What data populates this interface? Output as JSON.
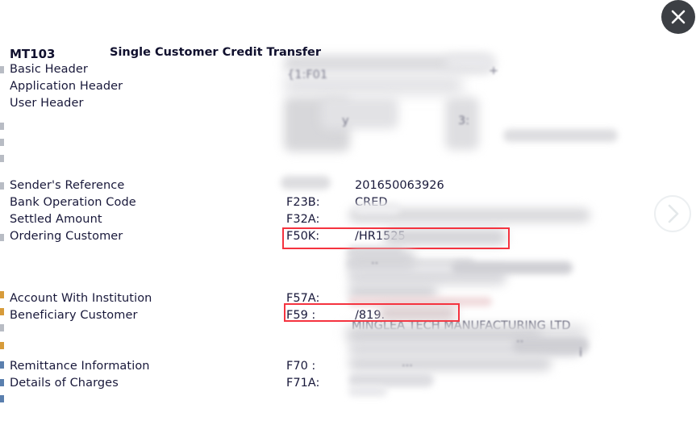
{
  "window": {
    "close_label": "×",
    "next_label": "›",
    "background": "#ffffff",
    "accent_red": "#f5333f",
    "text_color": "#18183a"
  },
  "message": {
    "type": "MT103",
    "description": "Single Customer Credit Transfer",
    "header_items": [
      {
        "label": "Basic Header"
      },
      {
        "label": "Application Header"
      },
      {
        "label": "User Header"
      }
    ],
    "fields": [
      {
        "label": "Sender's Reference",
        "tag": "",
        "tag_redacted": true,
        "value": "201650063926",
        "highlight": false
      },
      {
        "label": "Bank Operation Code",
        "tag": "F23B:",
        "tag_redacted": false,
        "value": "CRED",
        "highlight": false
      },
      {
        "label": "Settled Amount",
        "tag": "F32A:",
        "tag_redacted": false,
        "value": "",
        "value_redacted": true,
        "highlight": false
      },
      {
        "label": "Ordering Customer",
        "tag": "F50K:",
        "tag_redacted": false,
        "value": "/HR1525",
        "value_redacted": true,
        "highlight": true
      },
      {
        "label": "Account With Institution",
        "tag": "F57A:",
        "tag_redacted": false,
        "value": "",
        "value_redacted": true,
        "highlight": false
      },
      {
        "label": "Beneficiary Customer",
        "tag": "F59  :",
        "tag_redacted": false,
        "value": "/819.",
        "value_redacted": true,
        "highlight": true
      },
      {
        "label": "Remittance Information",
        "tag": "F70  :",
        "tag_redacted": false,
        "value": "",
        "value_redacted": true,
        "highlight": false
      },
      {
        "label": "Details of Charges",
        "tag": "F71A:",
        "tag_redacted": false,
        "value": "",
        "value_redacted": true,
        "highlight": false
      }
    ],
    "partial_text": {
      "beneficiary_name": "MINGLEA TECH MANUFACTURING LTD"
    }
  }
}
